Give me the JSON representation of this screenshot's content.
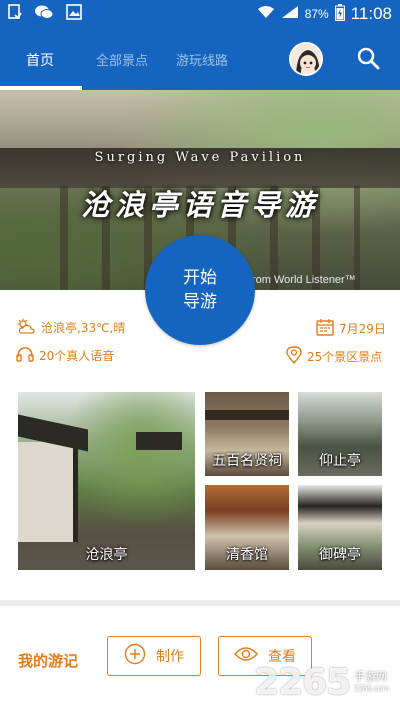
{
  "status_bar": {
    "battery_percent": "87%",
    "time": "11:08",
    "icons": [
      "document-icon",
      "wechat-icon",
      "image-icon",
      "wifi-icon",
      "signal-icon",
      "battery-icon"
    ]
  },
  "header": {
    "tabs": [
      {
        "label": "首页",
        "active": true
      },
      {
        "label": "全部景点",
        "active": false
      },
      {
        "label": "游玩线路",
        "active": false
      }
    ]
  },
  "banner": {
    "subtitle": "Surging Wave Pavilion",
    "title": "沧浪亭语音导游",
    "credit": "rom World Listener™"
  },
  "start_button": {
    "line1": "开始",
    "line2": "导游"
  },
  "info": {
    "weather": "沧浪亭,33℃,晴",
    "date": "7月29日",
    "voice": "20个真人语音",
    "spots": "25个景区景点"
  },
  "tiles": [
    {
      "label": "沧浪亭"
    },
    {
      "label": "五百名贤祠"
    },
    {
      "label": "仰止亭"
    },
    {
      "label": "清香馆"
    },
    {
      "label": "御碑亭"
    }
  ],
  "notes": {
    "title": "我的游记",
    "make_label": "制作",
    "view_label": "查看"
  },
  "watermark": {
    "logo": "2265",
    "name": "手游网",
    "url": "2265.com"
  },
  "colors": {
    "primary": "#1565c0",
    "accent": "#e27d1a"
  }
}
